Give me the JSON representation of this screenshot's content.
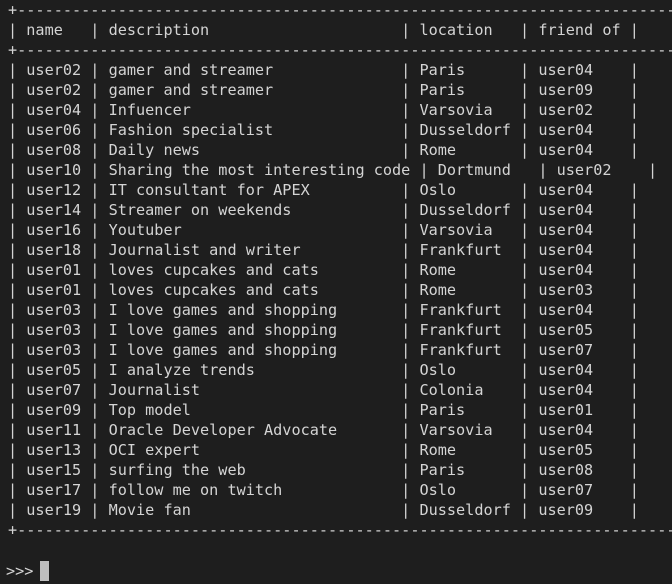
{
  "terminal": {
    "border_top": "+-------------------------------------------------------------------------+",
    "header_row": "| name   | description                     | location   | friend of |",
    "header_sep": "+-------------------------------------------------------------------------+",
    "rows": [
      "| user02 | gamer and streamer              | Paris      | user04    |",
      "| user02 | gamer and streamer              | Paris      | user09    |",
      "| user04 | Infuencer                       | Varsovia   | user02    |",
      "| user06 | Fashion specialist              | Dusseldorf | user04    |",
      "| user08 | Daily news                      | Rome       | user04    |",
      "| user10 | Sharing the most interesting code | Dortmund   | user02    |",
      "| user12 | IT consultant for APEX          | Oslo       | user04    |",
      "| user14 | Streamer on weekends            | Dusseldorf | user04    |",
      "| user16 | Youtuber                        | Varsovia   | user04    |",
      "| user18 | Journalist and writer           | Frankfurt  | user04    |",
      "| user01 | loves cupcakes and cats         | Rome       | user04    |",
      "| user01 | loves cupcakes and cats         | Rome       | user03    |",
      "| user03 | I love games and shopping       | Frankfurt  | user04    |",
      "| user03 | I love games and shopping       | Frankfurt  | user05    |",
      "| user03 | I love games and shopping       | Frankfurt  | user07    |",
      "| user05 | I analyze trends                | Oslo       | user04    |",
      "| user07 | Journalist                      | Colonia    | user04    |",
      "| user09 | Top model                       | Paris      | user01    |",
      "| user11 | Oracle Developer Advocate       | Varsovia   | user04    |",
      "| user13 | OCI expert                      | Rome       | user05    |",
      "| user15 | surfing the web                 | Paris      | user08    |",
      "| user17 | follow me on twitch             | Oslo       | user07    |",
      "| user19 | Movie fan                       | Dusseldorf | user09    |"
    ],
    "border_bottom": "+-------------------------------------------------------------------------+",
    "prompt": ">>>"
  }
}
